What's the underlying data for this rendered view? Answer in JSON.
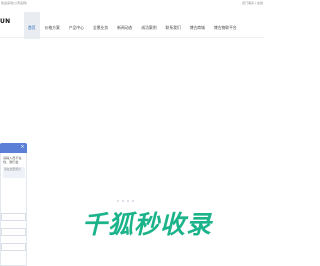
{
  "topbar": {
    "welcome": "欢迎来到(公司名称)",
    "links": "德门联系 | 在线"
  },
  "header": {
    "logo": "UN",
    "nav": [
      {
        "label": "首页",
        "active": true
      },
      {
        "label": "价格方案",
        "active": false
      },
      {
        "label": "产品中心",
        "active": false
      },
      {
        "label": "全景业务",
        "active": false
      },
      {
        "label": "新闻动态",
        "active": false
      },
      {
        "label": "成功案例",
        "active": false
      },
      {
        "label": "联系我们",
        "active": false
      },
      {
        "label": "博古商城",
        "active": false
      },
      {
        "label": "博古物联平台",
        "active": false
      }
    ]
  },
  "banner": {
    "brand": "千狐秒收录"
  },
  "chat": {
    "close_icon": "×",
    "message": "请输入员不在线，我们会",
    "bubble": "请在这里留言",
    "send_label": "发送"
  },
  "colors": {
    "accent": "#5b7fd6",
    "brand_green": "#1bb38a",
    "nav_active": "#1f5fb6"
  }
}
